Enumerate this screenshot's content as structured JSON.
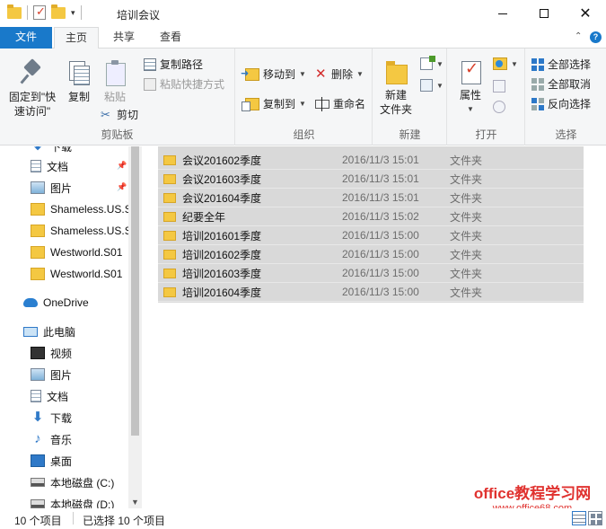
{
  "window": {
    "title": "培训会议",
    "minimize": "",
    "maximize": "",
    "close": "✕"
  },
  "tabs": [
    "文件",
    "主页",
    "共享",
    "查看"
  ],
  "ribbon": {
    "clipboard": {
      "label": "剪贴板",
      "pin_quick_access": "固定到\"快速访问\"",
      "copy": "复制",
      "paste": "粘贴",
      "copy_path": "复制路径",
      "paste_shortcut": "粘贴快捷方式",
      "cut": "剪切"
    },
    "organize": {
      "label": "组织",
      "move_to": "移动到",
      "copy_to": "复制到",
      "delete": "删除",
      "rename": "重命名"
    },
    "new": {
      "label": "新建",
      "new_folder": "新建\n文件夹"
    },
    "open": {
      "label": "打开",
      "properties": "属性"
    },
    "select": {
      "label": "选择",
      "select_all": "全部选择",
      "select_none": "全部取消",
      "invert": "反向选择"
    }
  },
  "nav": {
    "quick_access": [
      {
        "label": "下载",
        "icon": "download-icon"
      },
      {
        "label": "文档",
        "icon": "document-icon",
        "pinned": true
      },
      {
        "label": "图片",
        "icon": "picture-icon",
        "pinned": true
      },
      {
        "label": "Shameless.US.S",
        "icon": "folder-icon"
      },
      {
        "label": "Shameless.US.S",
        "icon": "folder-icon"
      },
      {
        "label": "Westworld.S01",
        "icon": "folder-icon"
      },
      {
        "label": "Westworld.S01",
        "icon": "folder-icon"
      }
    ],
    "onedrive": "OneDrive",
    "this_pc": "此电脑",
    "pc_items": [
      {
        "label": "视频",
        "icon": "video-icon"
      },
      {
        "label": "图片",
        "icon": "picture-icon"
      },
      {
        "label": "文档",
        "icon": "document-icon"
      },
      {
        "label": "下载",
        "icon": "download-icon"
      },
      {
        "label": "音乐",
        "icon": "music-icon"
      },
      {
        "label": "桌面",
        "icon": "desktop-icon"
      },
      {
        "label": "本地磁盘 (C:)",
        "icon": "drive-icon"
      },
      {
        "label": "本地磁盘 (D:)",
        "icon": "drive-icon"
      }
    ]
  },
  "files": [
    {
      "name": "会议201602季度",
      "date": "2016/11/3 15:01",
      "type": "文件夹"
    },
    {
      "name": "会议201603季度",
      "date": "2016/11/3 15:01",
      "type": "文件夹"
    },
    {
      "name": "会议201604季度",
      "date": "2016/11/3 15:01",
      "type": "文件夹"
    },
    {
      "name": "纪要全年",
      "date": "2016/11/3 15:02",
      "type": "文件夹"
    },
    {
      "name": "培训201601季度",
      "date": "2016/11/3 15:00",
      "type": "文件夹"
    },
    {
      "name": "培训201602季度",
      "date": "2016/11/3 15:00",
      "type": "文件夹"
    },
    {
      "name": "培训201603季度",
      "date": "2016/11/3 15:00",
      "type": "文件夹"
    },
    {
      "name": "培训201604季度",
      "date": "2016/11/3 15:00",
      "type": "文件夹"
    }
  ],
  "status": {
    "count": "10 个项目",
    "selected": "已选择 10 个项目"
  },
  "watermark": {
    "main": "office教程学习网",
    "url": "www.office68.com"
  },
  "colors": {
    "accent": "#1979ca",
    "selection": "#d9d9d9",
    "folder": "#f4c842"
  }
}
